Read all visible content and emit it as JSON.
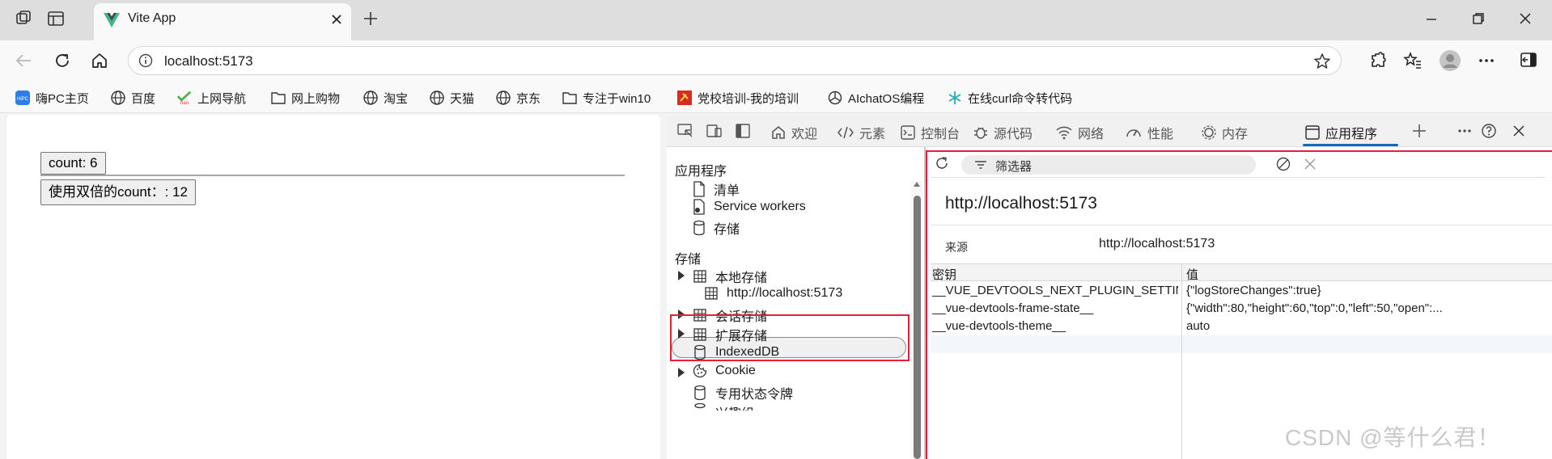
{
  "browser": {
    "tab_title": "Vite App",
    "url": "localhost:5173"
  },
  "bookmarks": [
    {
      "label": "嗨PC主页",
      "icon": "hipc-icon"
    },
    {
      "label": "百度",
      "icon": "globe-icon"
    },
    {
      "label": "上网导航",
      "icon": "hao-icon"
    },
    {
      "label": "网上购物",
      "icon": "folder-icon"
    },
    {
      "label": "淘宝",
      "icon": "globe-icon"
    },
    {
      "label": "天猫",
      "icon": "globe-icon"
    },
    {
      "label": "京东",
      "icon": "globe-icon"
    },
    {
      "label": "专注于win10",
      "icon": "folder-icon"
    },
    {
      "label": "党校培训-我的培训",
      "icon": "party-icon"
    },
    {
      "label": "AIchatOS编程",
      "icon": "openai-icon"
    },
    {
      "label": "在线curl命令转代码",
      "icon": "snowflake-icon"
    }
  ],
  "page": {
    "count_button": "count: 6",
    "double_button": "使用双倍的count：: 12"
  },
  "devtools": {
    "tabs": [
      {
        "label": "欢迎",
        "icon": "home-icon"
      },
      {
        "label": "元素",
        "icon": "code-icon"
      },
      {
        "label": "控制台",
        "icon": "console-icon"
      },
      {
        "label": "源代码",
        "icon": "bug-icon"
      },
      {
        "label": "网络",
        "icon": "wifi-icon"
      },
      {
        "label": "性能",
        "icon": "gauge-icon"
      },
      {
        "label": "内存",
        "icon": "chip-icon"
      },
      {
        "label": "应用程序",
        "icon": "app-icon"
      }
    ],
    "sidebar": {
      "section_app": "应用程序",
      "app_items": [
        "清单",
        "Service workers",
        "存储"
      ],
      "section_storage": "存储",
      "local_storage": "本地存储",
      "local_storage_origin": "http://localhost:5173",
      "session_storage": "会话存储",
      "extension_storage": "扩展存储",
      "indexeddb": "IndexedDB",
      "cookie": "Cookie",
      "private_state_tokens": "专用状态令牌",
      "cut_item": "兴趣组"
    },
    "panel": {
      "filter_placeholder": "筛选器",
      "origin_title": "http://localhost:5173",
      "origin_label": "来源",
      "origin_value": "http://localhost:5173",
      "columns": [
        "密钥",
        "值"
      ],
      "rows": [
        {
          "key": "__VUE_DEVTOOLS_NEXT_PLUGIN_SETTINGS__d...",
          "value": "{\"logStoreChanges\":true}"
        },
        {
          "key": "__vue-devtools-frame-state__",
          "value": "{\"width\":80,\"height\":60,\"top\":0,\"left\":50,\"open\":..."
        },
        {
          "key": "__vue-devtools-theme__",
          "value": "auto"
        }
      ]
    }
  },
  "watermark": "CSDN @等什么君！",
  "colors": {
    "accent": "#0f6cbd",
    "highlight": "#e5213a"
  }
}
